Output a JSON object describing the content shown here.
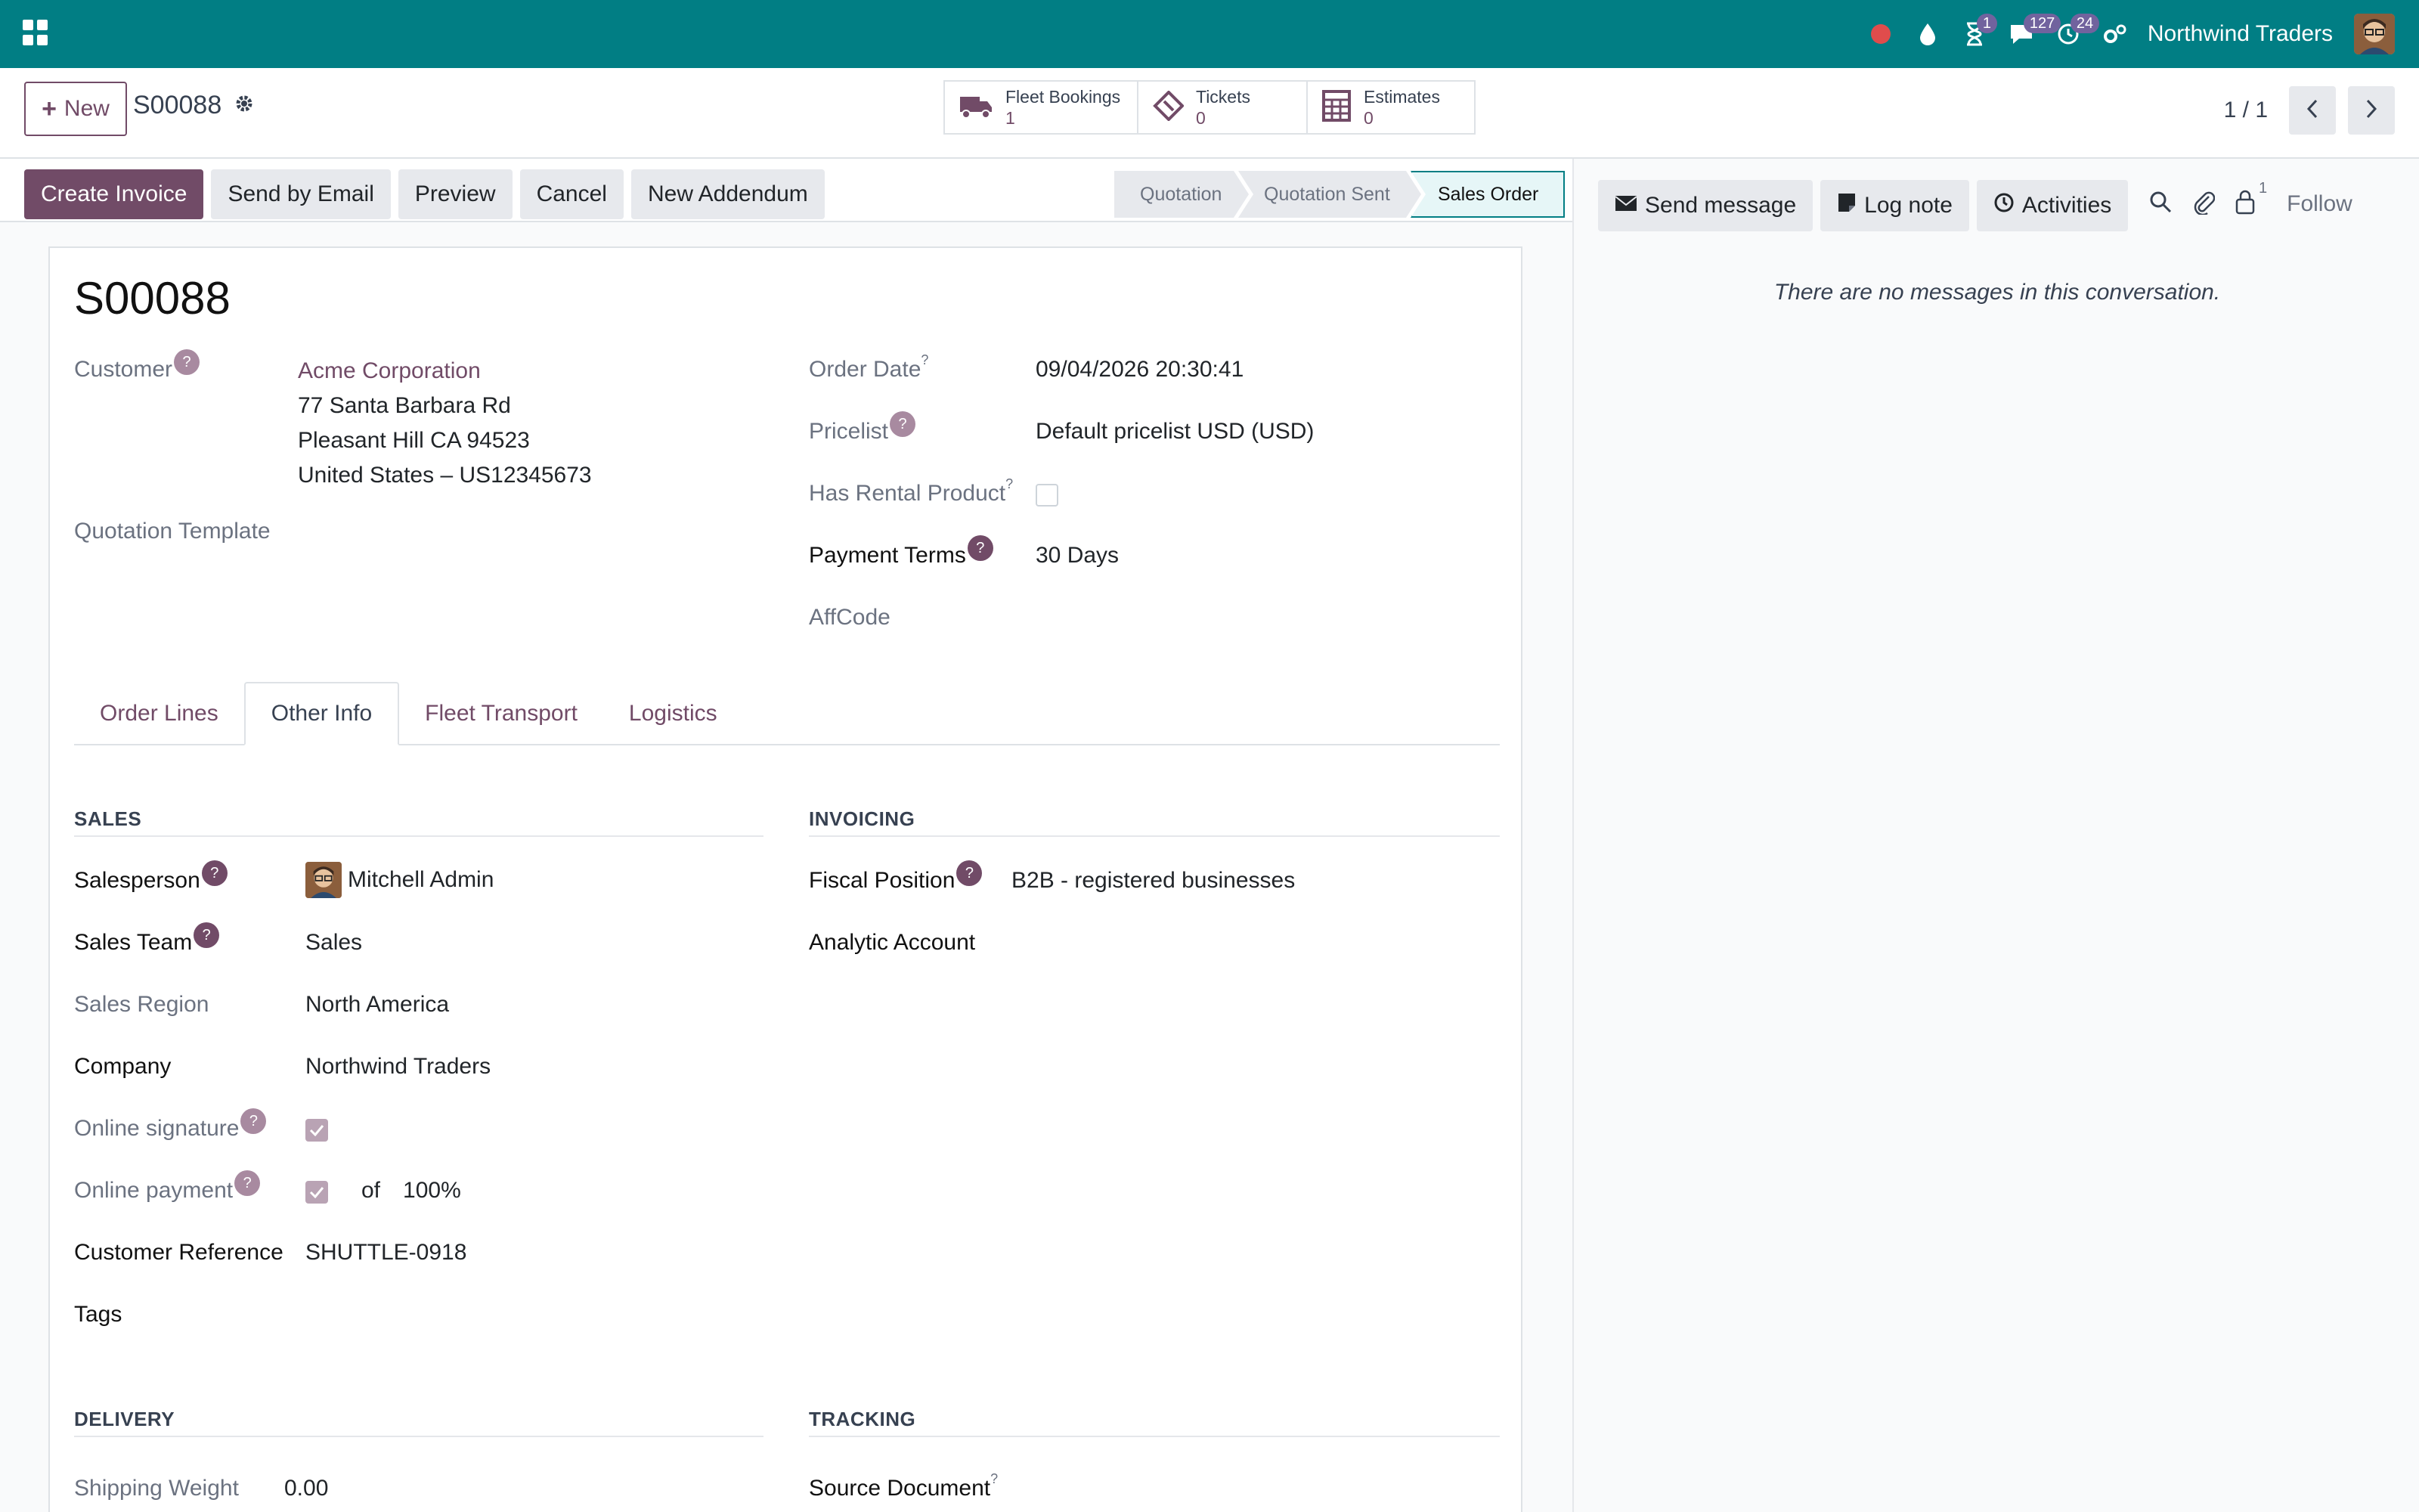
{
  "navbar": {
    "company": "Northwind Traders",
    "badges": {
      "activities": "1",
      "messages": "127",
      "timer": "24"
    },
    "colors": {
      "brand": "#017e84",
      "accent": "#714b67",
      "badge": "#71639e",
      "record": "#e04c4c"
    }
  },
  "control_panel": {
    "new_label": "New",
    "record_name": "S00088",
    "smart_buttons": [
      {
        "label": "Fleet Bookings",
        "value": "1",
        "icon": "truck-icon"
      },
      {
        "label": "Tickets",
        "value": "0",
        "icon": "ticket-icon"
      },
      {
        "label": "Estimates",
        "value": "0",
        "icon": "calculator-icon"
      }
    ],
    "pager": "1 / 1"
  },
  "statusbar": {
    "buttons": [
      "Create Invoice",
      "Send by Email",
      "Preview",
      "Cancel",
      "New Addendum"
    ],
    "stages": [
      "Quotation",
      "Quotation Sent",
      "Sales Order"
    ],
    "active_stage": "Sales Order"
  },
  "form": {
    "title": "S00088",
    "customer_label": "Customer",
    "customer_name": "Acme Corporation",
    "address": [
      "77 Santa Barbara Rd",
      "Pleasant Hill CA 94523",
      "United States – US12345673"
    ],
    "quotation_template_label": "Quotation Template",
    "order_date_label": "Order Date",
    "order_date": "09/04/2026 20:30:41",
    "pricelist_label": "Pricelist",
    "pricelist": "Default pricelist USD (USD)",
    "rental_label": "Has Rental Product",
    "payment_terms_label": "Payment Terms",
    "payment_terms": "30 Days",
    "affcode_label": "AffCode",
    "help_mark": "?"
  },
  "tabs": [
    "Order Lines",
    "Other Info",
    "Fleet Transport",
    "Logistics"
  ],
  "other_info": {
    "sales_title": "SALES",
    "invoicing_title": "INVOICING",
    "salesperson_label": "Salesperson",
    "salesperson": "Mitchell Admin",
    "sales_team_label": "Sales Team",
    "sales_team": "Sales",
    "sales_region_label": "Sales Region",
    "sales_region": "North America",
    "company_label": "Company",
    "company": "Northwind Traders",
    "online_signature_label": "Online signature",
    "online_payment_label": "Online payment",
    "of_label": "of",
    "payment_percent": "100%",
    "customer_ref_label": "Customer Reference",
    "customer_ref": "SHUTTLE-0918",
    "tags_label": "Tags",
    "fiscal_position_label": "Fiscal Position",
    "fiscal_position": "B2B - registered businesses",
    "analytic_label": "Analytic Account",
    "delivery_title": "DELIVERY",
    "tracking_title": "TRACKING",
    "shipping_weight_label": "Shipping Weight",
    "shipping_weight": "0.00",
    "source_document_label": "Source Document"
  },
  "chatter": {
    "send_message": "Send message",
    "log_note": "Log note",
    "activities": "Activities",
    "followers_count": "1",
    "follow": "Follow",
    "empty": "There are no messages in this conversation."
  }
}
